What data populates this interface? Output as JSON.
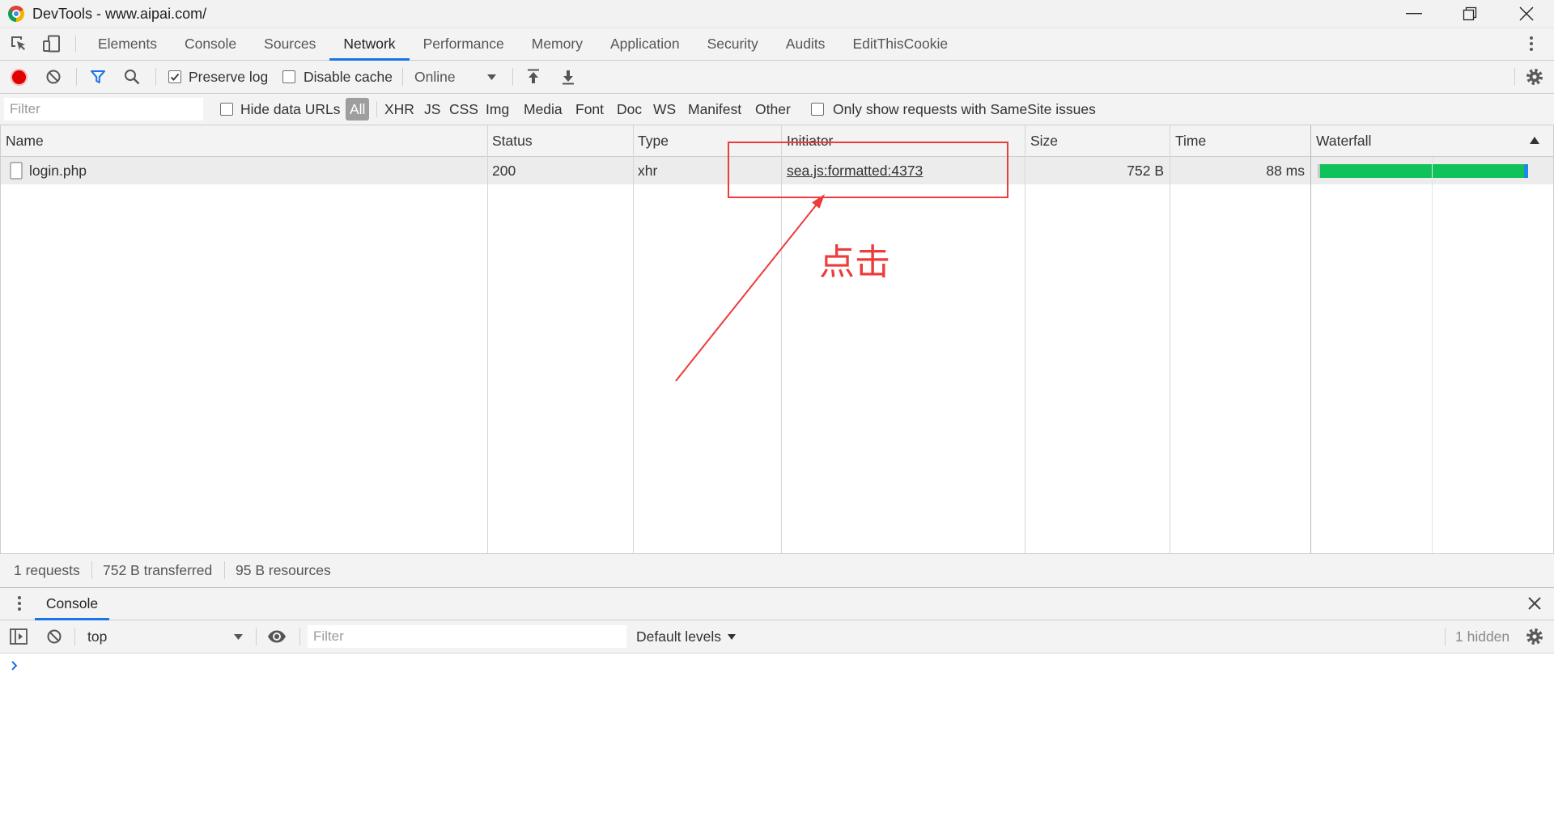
{
  "window": {
    "title": "DevTools - www.aipai.com/"
  },
  "colors": {
    "accent": "#1a73e8",
    "record": "#e00000",
    "annotation": "#ee3b3b",
    "waterfall_bar": "#10c25a",
    "waterfall_tip": "#1e88e5"
  },
  "icons": {
    "app": "chrome-logo-icon",
    "inspect": "inspect-element-icon",
    "device": "device-toolbar-icon",
    "record": "record-icon",
    "clear": "clear-icon",
    "filter": "filter-icon",
    "search": "search-icon",
    "import": "import-har-icon",
    "export": "export-har-icon",
    "settings": "gear-icon",
    "more": "kebab-menu-icon",
    "close": "close-icon",
    "eye": "eye-icon",
    "sidebar": "console-sidebar-icon",
    "sort": "sort-ascending-icon",
    "prompt": "prompt-chevron-icon",
    "file": "file-icon"
  },
  "tabs": [
    {
      "label": "Elements",
      "active": false
    },
    {
      "label": "Console",
      "active": false
    },
    {
      "label": "Sources",
      "active": false
    },
    {
      "label": "Network",
      "active": true
    },
    {
      "label": "Performance",
      "active": false
    },
    {
      "label": "Memory",
      "active": false
    },
    {
      "label": "Application",
      "active": false
    },
    {
      "label": "Security",
      "active": false
    },
    {
      "label": "Audits",
      "active": false
    },
    {
      "label": "EditThisCookie",
      "active": false
    }
  ],
  "toolbar": {
    "recording": true,
    "preserve_log": {
      "label": "Preserve log",
      "checked": true
    },
    "disable_cache": {
      "label": "Disable cache",
      "checked": false
    },
    "throttling": {
      "selected": "Online"
    }
  },
  "filter_bar": {
    "placeholder": "Filter",
    "hide_data_urls": {
      "label": "Hide data URLs",
      "checked": false
    },
    "types": [
      {
        "label": "All",
        "active": true
      },
      {
        "label": "XHR",
        "active": false
      },
      {
        "label": "JS",
        "active": false
      },
      {
        "label": "CSS",
        "active": false
      },
      {
        "label": "Img",
        "active": false
      },
      {
        "label": "Media",
        "active": false
      },
      {
        "label": "Font",
        "active": false
      },
      {
        "label": "Doc",
        "active": false
      },
      {
        "label": "WS",
        "active": false
      },
      {
        "label": "Manifest",
        "active": false
      },
      {
        "label": "Other",
        "active": false
      }
    ],
    "samesite": {
      "label": "Only show requests with SameSite issues",
      "checked": false
    }
  },
  "requests_table": {
    "columns": [
      "Name",
      "Status",
      "Type",
      "Initiator",
      "Size",
      "Time",
      "Waterfall"
    ],
    "rows": [
      {
        "name": "login.php",
        "status": "200",
        "type": "xhr",
        "initiator": "sea.js:formatted:4373",
        "size": "752 B",
        "time": "88 ms"
      }
    ]
  },
  "summary": {
    "requests": "1 requests",
    "transferred": "752 B transferred",
    "resources": "95 B resources"
  },
  "drawer": {
    "tab": "Console",
    "context": "top",
    "filter_placeholder": "Filter",
    "log_levels": "Default levels",
    "hidden_count": "1 hidden"
  },
  "annotation": {
    "text": "点击"
  }
}
